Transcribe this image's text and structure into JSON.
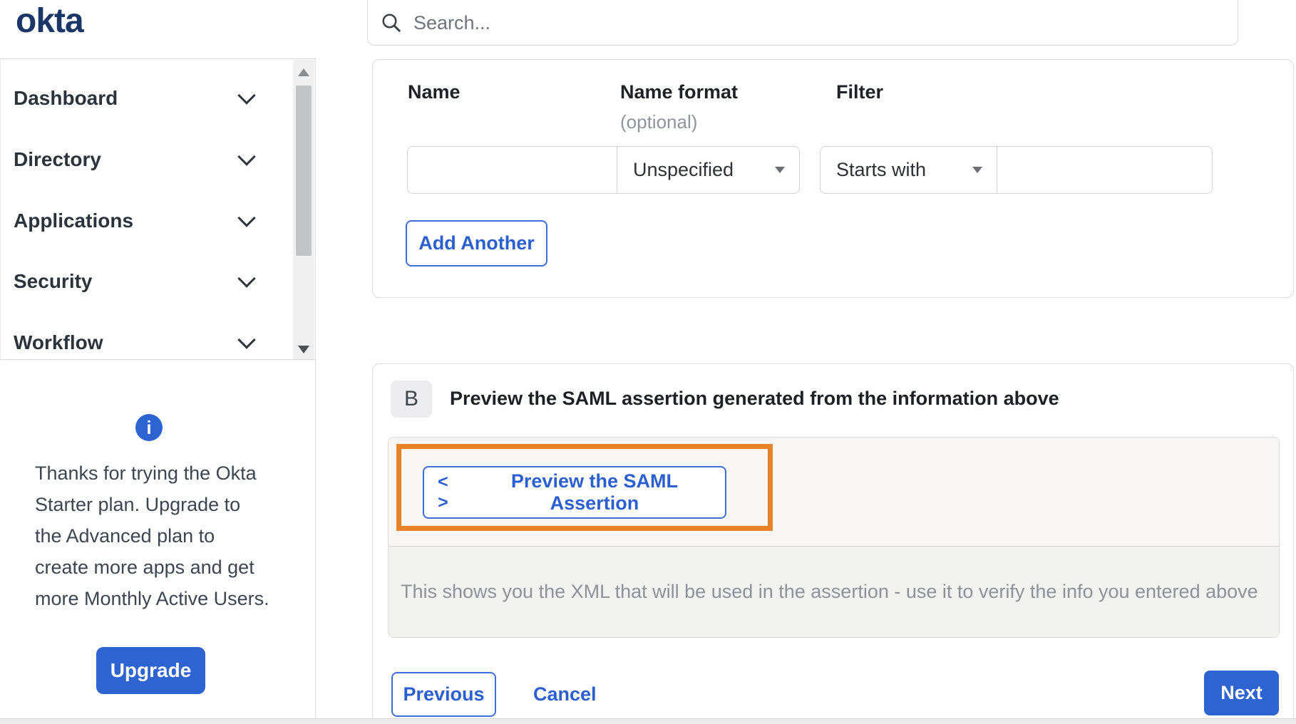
{
  "brand": {
    "logo_text": "okta",
    "logo_color": "#1a3767"
  },
  "search": {
    "placeholder": "Search..."
  },
  "sidebar": {
    "items": [
      {
        "label": "Dashboard"
      },
      {
        "label": "Directory"
      },
      {
        "label": "Applications"
      },
      {
        "label": "Security"
      },
      {
        "label": "Workflow"
      }
    ],
    "upgrade_panel": {
      "text_lines": [
        "Thanks for trying the Okta",
        "Starter plan. Upgrade to",
        "the Advanced plan to",
        "create more apps and get",
        "more Monthly Active Users."
      ],
      "button_label": "Upgrade"
    }
  },
  "form": {
    "name_label": "Name",
    "name_format_label": "Name format",
    "name_format_optional": "(optional)",
    "filter_label": "Filter",
    "name_value": "",
    "name_format_value": "Unspecified",
    "filter_operator_value": "Starts with",
    "filter_value": "",
    "add_another_label": "Add Another"
  },
  "section_b": {
    "badge": "B",
    "heading": "Preview the SAML assertion generated from the information above",
    "preview_icon": "< >",
    "preview_button_label": "Preview the SAML Assertion",
    "description": "This shows you the XML that will be used in the assertion - use it to verify the info you entered above"
  },
  "footer": {
    "previous_label": "Previous",
    "cancel_label": "Cancel",
    "next_label": "Next"
  },
  "colors": {
    "accent_blue": "#2e63d2",
    "navy": "#1a3767",
    "highlight_orange": "#e8832c"
  }
}
